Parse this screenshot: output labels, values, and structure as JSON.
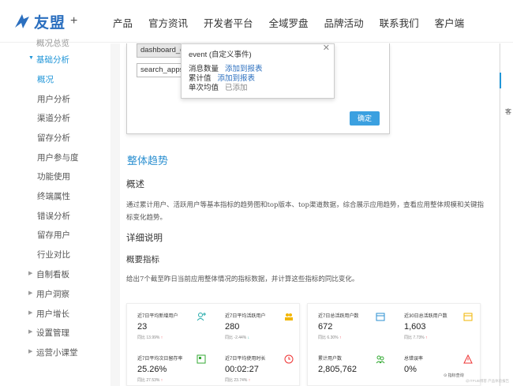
{
  "header": {
    "brand": "友盟",
    "brand_plus": "+",
    "nav": [
      "产品",
      "官方资讯",
      "开发者平台",
      "全域罗盘",
      "品牌活动",
      "联系我们",
      "客户端"
    ]
  },
  "sidebar": {
    "top_partial": "概况总览",
    "group_open": "基础分析",
    "children": [
      "概况",
      "用户分析",
      "渠道分析",
      "留存分析",
      "用户参与度",
      "功能使用",
      "终端属性",
      "错误分析",
      "留存用户",
      "行业对比"
    ],
    "groups": [
      "自制看板",
      "用户洞察",
      "用户增长",
      "设置管理",
      "运营小课堂"
    ]
  },
  "modal": {
    "field1": "dashboard_d",
    "field2": "search_apps",
    "popover": {
      "title": "event (自定义事件)",
      "rows": [
        {
          "label": "消息数量",
          "action": "添加到报表"
        },
        {
          "label": "累计值",
          "action": "添加到报表"
        },
        {
          "label": "单次均值",
          "status": "已添加"
        }
      ]
    },
    "confirm": "确定"
  },
  "content": {
    "section_title": "整体趋势",
    "overview_title": "概述",
    "overview_text": "通过累计用户、活跃用户等基本指标的趋势图和top版本、top渠道数据，综合展示应用趋势，查看应用整体规模和关键指标变化趋势。",
    "detail_title": "详细说明",
    "summary_title": "概要指标",
    "summary_text": "给出7个截至昨日当前应用整体情况的指标数据，并计算这些指标的同比变化。"
  },
  "metrics": [
    {
      "label": "近7日平均新增用户",
      "value": "23",
      "cmp": "同比",
      "change": "13.99%",
      "trend": "up"
    },
    {
      "label": "近7日平均活跃用户",
      "value": "280",
      "cmp": "同比",
      "change": "-2.44%",
      "trend": "down"
    },
    {
      "label": "近7日平均次日留存率",
      "value": "25.26%",
      "cmp": "同比",
      "change": "27.53%",
      "trend": "up"
    },
    {
      "label": "近7日平均使用时长",
      "value": "00:02:27",
      "cmp": "同比",
      "change": "23.74%",
      "trend": "up"
    },
    {
      "label": "近7日总活跃用户数",
      "value": "672",
      "cmp": "同比",
      "change": "6.30%",
      "trend": "up"
    },
    {
      "label": "近30日总活跃用户数",
      "value": "1,603",
      "cmp": "同比",
      "change": "7.73%",
      "trend": "up"
    },
    {
      "label": "累计用户数",
      "value": "2,805,762",
      "cmp": "",
      "change": "",
      "trend": ""
    },
    {
      "label": "总错误率",
      "value": "0%",
      "cmp": "",
      "change": "",
      "trend": ""
    }
  ],
  "misc": {
    "right_edge_text": "客",
    "float_btn": "指标查询",
    "watermark": "@ITPUB博客 产品体验报告"
  },
  "colors": {
    "accent": "#2196d8",
    "brand": "#2b6fbf",
    "button": "#3ba0e0"
  }
}
